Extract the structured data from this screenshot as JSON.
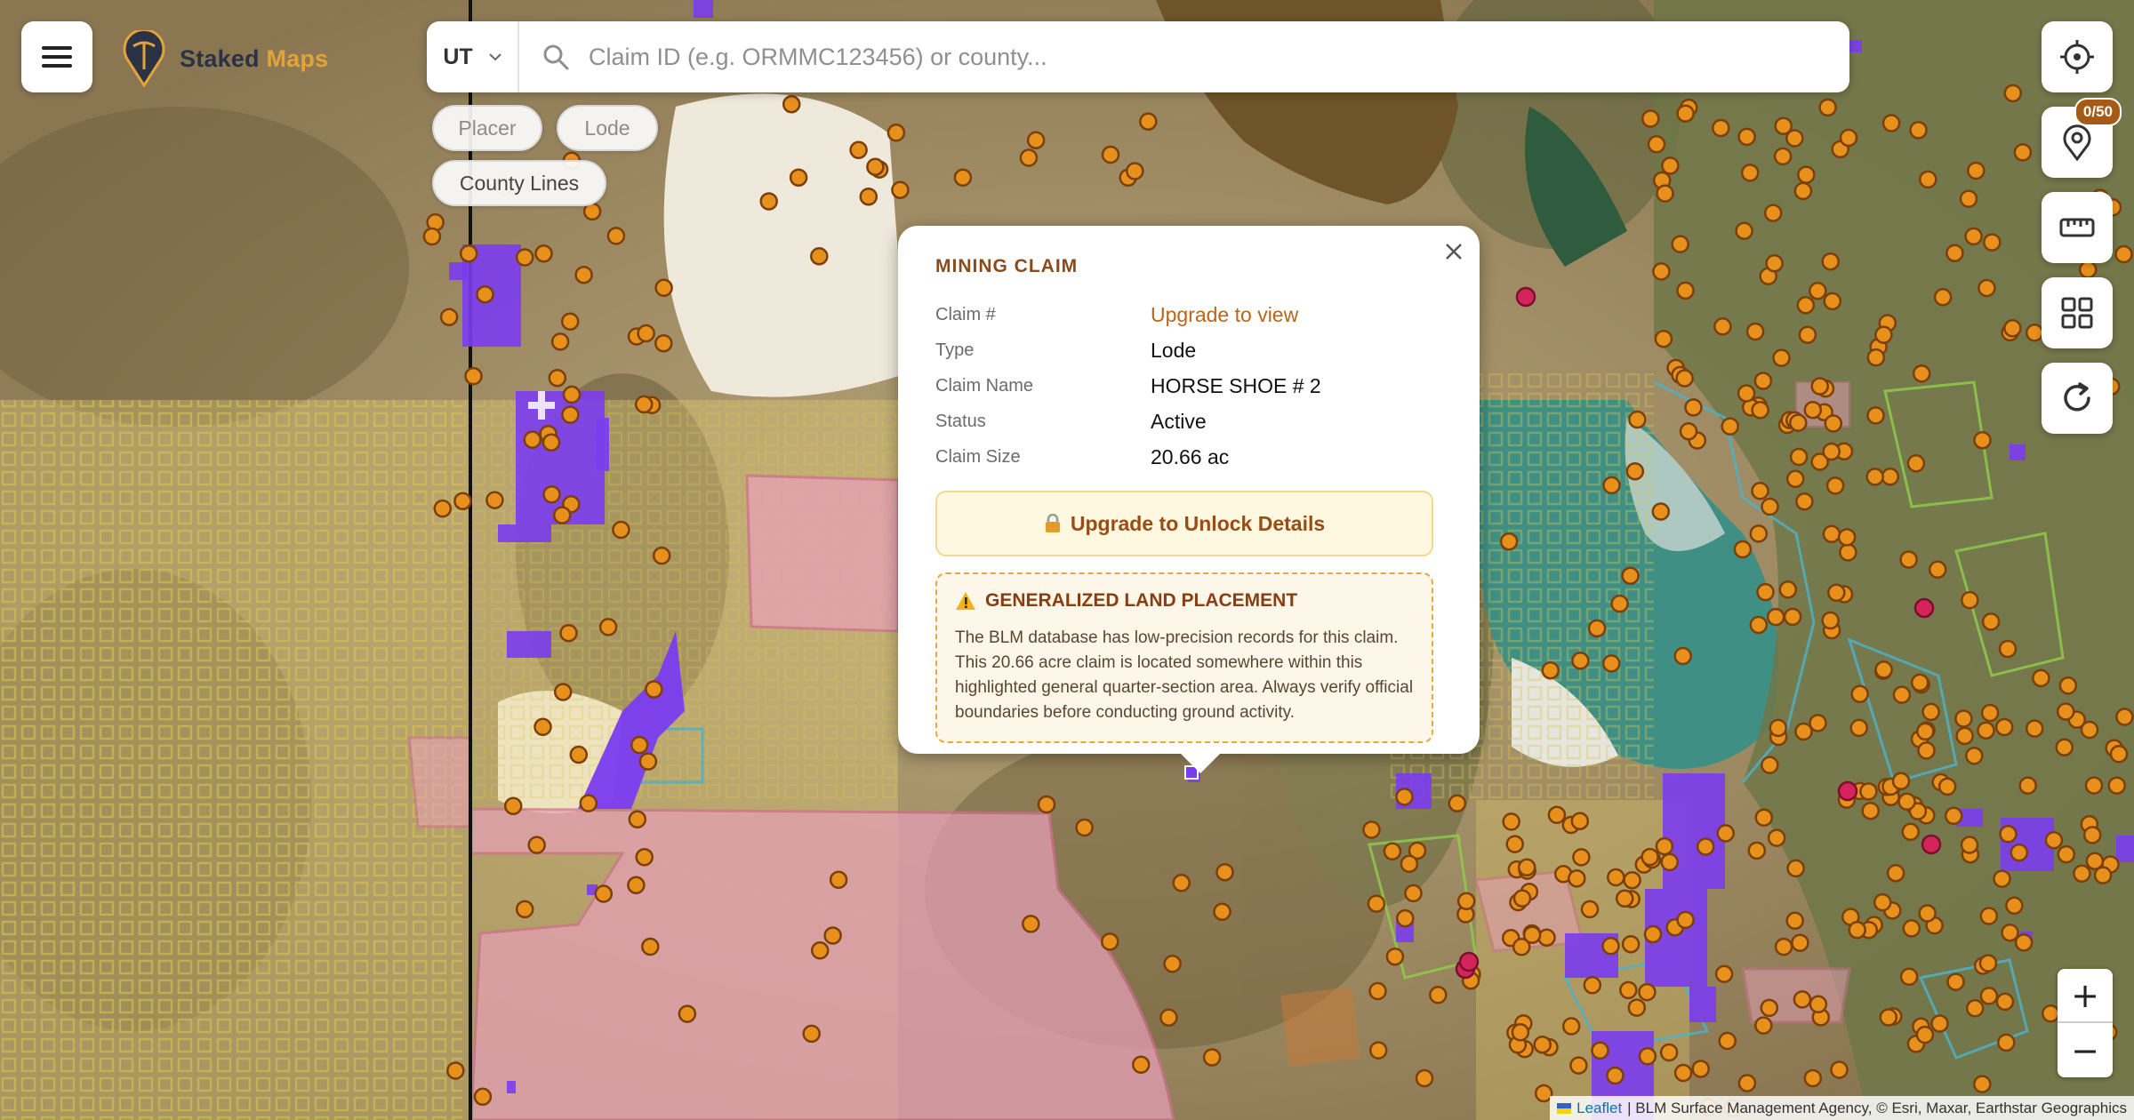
{
  "app": {
    "brand_part1": "Staked",
    "brand_part2": "Maps",
    "accent_color": "#e4a33a",
    "dark_color": "#2a3245"
  },
  "search": {
    "state_value": "UT",
    "placeholder": "Claim ID (e.g. ORMMC123456) or county..."
  },
  "filters": {
    "placer_label": "Placer",
    "lode_label": "Lode",
    "county_label": "County Lines"
  },
  "right_controls": {
    "pins_badge": "0/50",
    "icons": [
      "crosshair-icon",
      "map-pin-icon",
      "ruler-icon",
      "grid-icon",
      "refresh-icon"
    ]
  },
  "zoom": {
    "in_label": "+",
    "out_label": "−"
  },
  "attribution": {
    "leaflet_label": "Leaflet",
    "sources": "| BLM Surface Management Agency, © Esri, Maxar, Earthstar Geographics"
  },
  "popup": {
    "title": "MINING CLAIM",
    "fields": [
      {
        "label": "Claim #",
        "value": "Upgrade to view"
      },
      {
        "label": "Type",
        "value": "Lode"
      },
      {
        "label": "Claim Name",
        "value": "HORSE SHOE # 2"
      },
      {
        "label": "Status",
        "value": "Active"
      },
      {
        "label": "Claim Size",
        "value": "20.66 ac"
      }
    ],
    "unlock_label": "Upgrade to Unlock Details",
    "warning_title": "GENERALIZED LAND PLACEMENT",
    "warning_text": "The BLM database has low-precision records for this claim. This 20.66 acre claim is located somewhere within this highlighted general quarter-section area. Always verify official boundaries before conducting ground activity."
  },
  "map_colors": {
    "lode_claim": "#e8901c",
    "placer_claim": "#7b3cf0",
    "active_claim_red": "#d4245a",
    "blm_pink": "#e7a0b8",
    "state_yellow": "#e6d27a",
    "water": "#3f8f85"
  }
}
